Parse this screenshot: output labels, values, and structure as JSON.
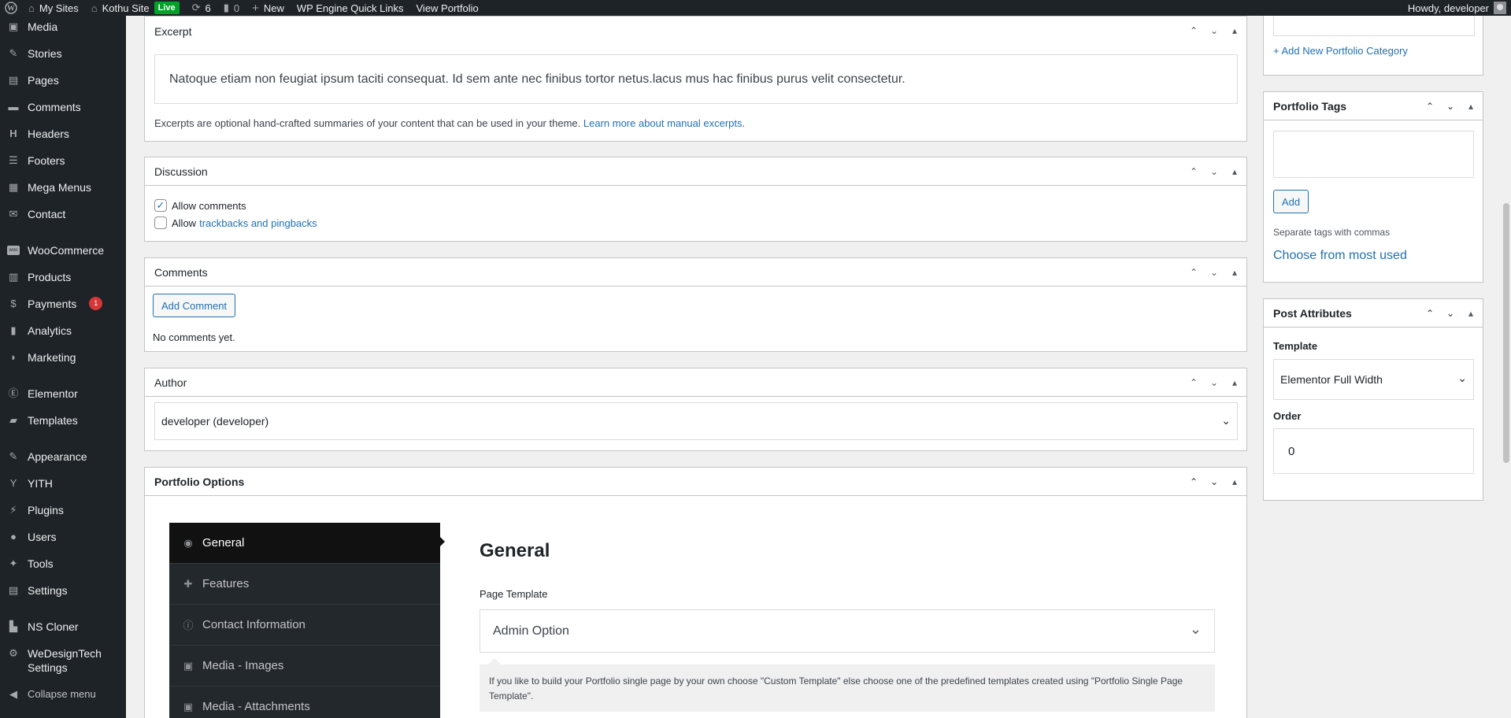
{
  "adminbar": {
    "my_sites": "My Sites",
    "site_name": "Kothu Site",
    "live": "Live",
    "updates_count": "6",
    "comments_count": "0",
    "new_label": "New",
    "quick_links": "WP Engine Quick Links",
    "view_portfolio": "View Portfolio",
    "howdy": "Howdy, developer"
  },
  "sidebar": {
    "items": [
      {
        "label": "Media",
        "icon": "media-icon"
      },
      {
        "label": "Stories",
        "icon": "stories-icon"
      },
      {
        "label": "Pages",
        "icon": "pages-icon"
      },
      {
        "label": "Comments",
        "icon": "comments-icon"
      },
      {
        "label": "Headers",
        "icon": "headers-icon"
      },
      {
        "label": "Footers",
        "icon": "footers-icon"
      },
      {
        "label": "Mega Menus",
        "icon": "mega-menus-icon"
      },
      {
        "label": "Contact",
        "icon": "contact-icon"
      },
      {
        "label": "WooCommerce",
        "icon": "woocommerce-icon"
      },
      {
        "label": "Products",
        "icon": "products-icon"
      },
      {
        "label": "Payments",
        "icon": "payments-icon",
        "badge": "1"
      },
      {
        "label": "Analytics",
        "icon": "analytics-icon"
      },
      {
        "label": "Marketing",
        "icon": "marketing-icon"
      },
      {
        "label": "Elementor",
        "icon": "elementor-icon"
      },
      {
        "label": "Templates",
        "icon": "templates-icon"
      },
      {
        "label": "Appearance",
        "icon": "appearance-icon"
      },
      {
        "label": "YITH",
        "icon": "yith-icon"
      },
      {
        "label": "Plugins",
        "icon": "plugins-icon"
      },
      {
        "label": "Users",
        "icon": "users-icon"
      },
      {
        "label": "Tools",
        "icon": "tools-icon"
      },
      {
        "label": "Settings",
        "icon": "settings-icon"
      },
      {
        "label": "NS Cloner",
        "icon": "ns-cloner-icon"
      },
      {
        "label": "WeDesignTech Settings",
        "icon": "gear-icon"
      },
      {
        "label": "Collapse menu",
        "icon": "collapse-icon"
      }
    ]
  },
  "excerpt": {
    "title": "Excerpt",
    "text": "Natoque etiam non feugiat ipsum taciti consequat. Id sem ante nec finibus tortor netus.lacus mus hac finibus purus velit consectetur.",
    "help": "Excerpts are optional hand-crafted summaries of your content that can be used in your theme.",
    "help_link": "Learn more about manual excerpts"
  },
  "discussion": {
    "title": "Discussion",
    "allow_comments": "Allow comments",
    "allow_prefix": "Allow",
    "trackbacks_link": "trackbacks and pingbacks"
  },
  "comments_box": {
    "title": "Comments",
    "add_comment": "Add Comment",
    "empty": "No comments yet."
  },
  "author": {
    "title": "Author",
    "selected": "developer (developer)"
  },
  "portfolio_options": {
    "title": "Portfolio Options",
    "nav": [
      {
        "label": "General",
        "icon": "eye-icon"
      },
      {
        "label": "Features",
        "icon": "puzzle-icon"
      },
      {
        "label": "Contact Information",
        "icon": "info-icon"
      },
      {
        "label": "Media - Images",
        "icon": "camera-icon"
      },
      {
        "label": "Media - Attachments",
        "icon": "camera-icon"
      }
    ],
    "heading": "General",
    "page_template_label": "Page Template",
    "page_template_value": "Admin Option",
    "help": "If you like to build your Portfolio single page by your own choose \"Custom Template\" else choose one of the predefined templates created using \"Portfolio Single Page Template\"."
  },
  "right_col": {
    "add_category": "+ Add New Portfolio Category",
    "tags_title": "Portfolio Tags",
    "add_button": "Add",
    "tags_help": "Separate tags with commas",
    "choose_most_used": "Choose from most used",
    "attributes_title": "Post Attributes",
    "template_label": "Template",
    "template_value": "Elementor Full Width",
    "order_label": "Order",
    "order_value": "0"
  }
}
